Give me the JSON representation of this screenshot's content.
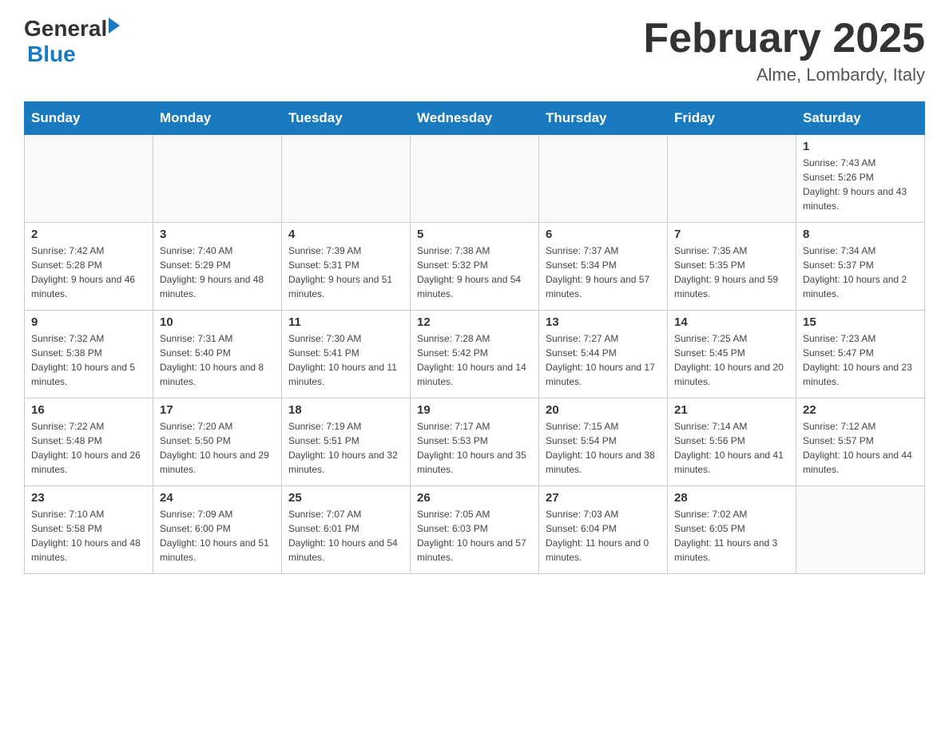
{
  "header": {
    "logo_general": "General",
    "logo_blue": "Blue",
    "month_title": "February 2025",
    "location": "Alme, Lombardy, Italy"
  },
  "days_of_week": [
    "Sunday",
    "Monday",
    "Tuesday",
    "Wednesday",
    "Thursday",
    "Friday",
    "Saturday"
  ],
  "weeks": [
    {
      "days": [
        {
          "number": "",
          "info": ""
        },
        {
          "number": "",
          "info": ""
        },
        {
          "number": "",
          "info": ""
        },
        {
          "number": "",
          "info": ""
        },
        {
          "number": "",
          "info": ""
        },
        {
          "number": "",
          "info": ""
        },
        {
          "number": "1",
          "info": "Sunrise: 7:43 AM\nSunset: 5:26 PM\nDaylight: 9 hours and 43 minutes."
        }
      ]
    },
    {
      "days": [
        {
          "number": "2",
          "info": "Sunrise: 7:42 AM\nSunset: 5:28 PM\nDaylight: 9 hours and 46 minutes."
        },
        {
          "number": "3",
          "info": "Sunrise: 7:40 AM\nSunset: 5:29 PM\nDaylight: 9 hours and 48 minutes."
        },
        {
          "number": "4",
          "info": "Sunrise: 7:39 AM\nSunset: 5:31 PM\nDaylight: 9 hours and 51 minutes."
        },
        {
          "number": "5",
          "info": "Sunrise: 7:38 AM\nSunset: 5:32 PM\nDaylight: 9 hours and 54 minutes."
        },
        {
          "number": "6",
          "info": "Sunrise: 7:37 AM\nSunset: 5:34 PM\nDaylight: 9 hours and 57 minutes."
        },
        {
          "number": "7",
          "info": "Sunrise: 7:35 AM\nSunset: 5:35 PM\nDaylight: 9 hours and 59 minutes."
        },
        {
          "number": "8",
          "info": "Sunrise: 7:34 AM\nSunset: 5:37 PM\nDaylight: 10 hours and 2 minutes."
        }
      ]
    },
    {
      "days": [
        {
          "number": "9",
          "info": "Sunrise: 7:32 AM\nSunset: 5:38 PM\nDaylight: 10 hours and 5 minutes."
        },
        {
          "number": "10",
          "info": "Sunrise: 7:31 AM\nSunset: 5:40 PM\nDaylight: 10 hours and 8 minutes."
        },
        {
          "number": "11",
          "info": "Sunrise: 7:30 AM\nSunset: 5:41 PM\nDaylight: 10 hours and 11 minutes."
        },
        {
          "number": "12",
          "info": "Sunrise: 7:28 AM\nSunset: 5:42 PM\nDaylight: 10 hours and 14 minutes."
        },
        {
          "number": "13",
          "info": "Sunrise: 7:27 AM\nSunset: 5:44 PM\nDaylight: 10 hours and 17 minutes."
        },
        {
          "number": "14",
          "info": "Sunrise: 7:25 AM\nSunset: 5:45 PM\nDaylight: 10 hours and 20 minutes."
        },
        {
          "number": "15",
          "info": "Sunrise: 7:23 AM\nSunset: 5:47 PM\nDaylight: 10 hours and 23 minutes."
        }
      ]
    },
    {
      "days": [
        {
          "number": "16",
          "info": "Sunrise: 7:22 AM\nSunset: 5:48 PM\nDaylight: 10 hours and 26 minutes."
        },
        {
          "number": "17",
          "info": "Sunrise: 7:20 AM\nSunset: 5:50 PM\nDaylight: 10 hours and 29 minutes."
        },
        {
          "number": "18",
          "info": "Sunrise: 7:19 AM\nSunset: 5:51 PM\nDaylight: 10 hours and 32 minutes."
        },
        {
          "number": "19",
          "info": "Sunrise: 7:17 AM\nSunset: 5:53 PM\nDaylight: 10 hours and 35 minutes."
        },
        {
          "number": "20",
          "info": "Sunrise: 7:15 AM\nSunset: 5:54 PM\nDaylight: 10 hours and 38 minutes."
        },
        {
          "number": "21",
          "info": "Sunrise: 7:14 AM\nSunset: 5:56 PM\nDaylight: 10 hours and 41 minutes."
        },
        {
          "number": "22",
          "info": "Sunrise: 7:12 AM\nSunset: 5:57 PM\nDaylight: 10 hours and 44 minutes."
        }
      ]
    },
    {
      "days": [
        {
          "number": "23",
          "info": "Sunrise: 7:10 AM\nSunset: 5:58 PM\nDaylight: 10 hours and 48 minutes."
        },
        {
          "number": "24",
          "info": "Sunrise: 7:09 AM\nSunset: 6:00 PM\nDaylight: 10 hours and 51 minutes."
        },
        {
          "number": "25",
          "info": "Sunrise: 7:07 AM\nSunset: 6:01 PM\nDaylight: 10 hours and 54 minutes."
        },
        {
          "number": "26",
          "info": "Sunrise: 7:05 AM\nSunset: 6:03 PM\nDaylight: 10 hours and 57 minutes."
        },
        {
          "number": "27",
          "info": "Sunrise: 7:03 AM\nSunset: 6:04 PM\nDaylight: 11 hours and 0 minutes."
        },
        {
          "number": "28",
          "info": "Sunrise: 7:02 AM\nSunset: 6:05 PM\nDaylight: 11 hours and 3 minutes."
        },
        {
          "number": "",
          "info": ""
        }
      ]
    }
  ]
}
